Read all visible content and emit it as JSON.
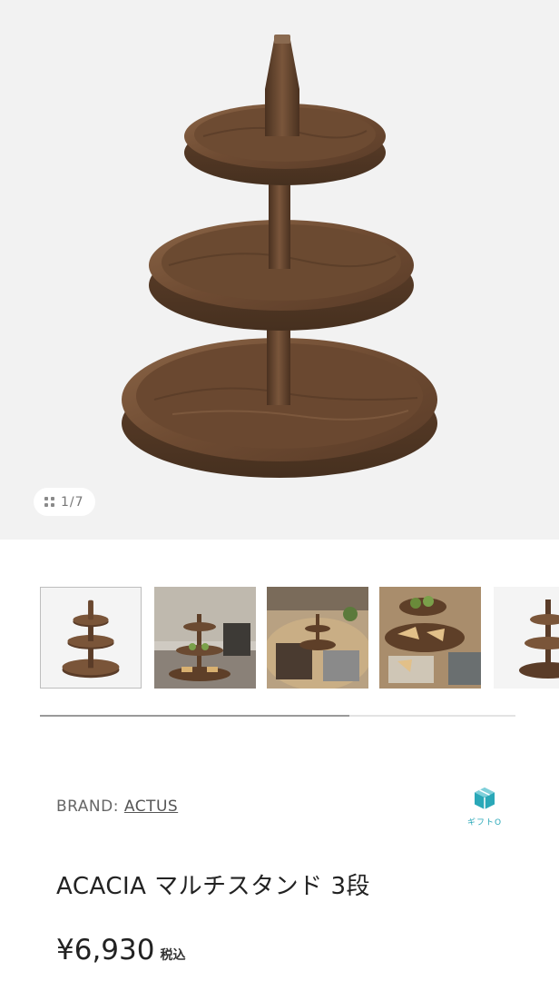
{
  "gallery": {
    "current": "1",
    "total": "7",
    "counter_text": "1/7",
    "grid_icon": "grid-icon",
    "thumbnails": [
      {
        "name": "thumb-stand-white",
        "selected": true
      },
      {
        "name": "thumb-stand-living-room",
        "selected": false
      },
      {
        "name": "thumb-stand-dining-table",
        "selected": false
      },
      {
        "name": "thumb-stand-food-closeup",
        "selected": false
      },
      {
        "name": "thumb-stand-partial",
        "selected": false
      }
    ],
    "scroll_progress": 0.65
  },
  "product": {
    "brand_label": "BRAND: ",
    "brand_name": "ACTUS",
    "gift_icon": "gift-box-icon",
    "gift_label": "ギフトO",
    "title": "ACACIA マルチスタンド 3段",
    "price": "¥6,930",
    "tax_label": "税込"
  },
  "colors": {
    "hero_bg": "#f2f2f2",
    "wood": "#6b4a33",
    "accent": "#2aa8b8"
  }
}
